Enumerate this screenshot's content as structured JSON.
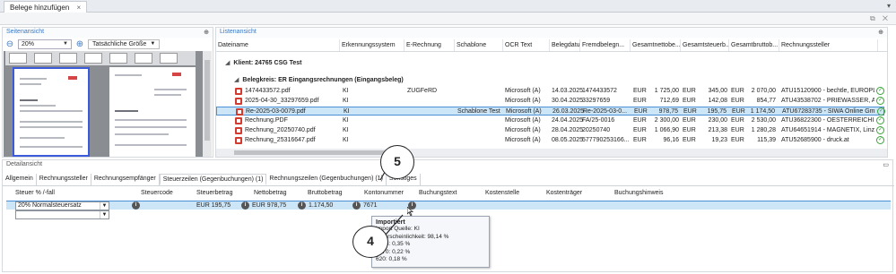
{
  "window": {
    "tab_title": "Belege hinzufügen",
    "tab_close": "×",
    "right_caret": "▾",
    "sub_icons": "⧉ ✕"
  },
  "left_panel": {
    "title": "Seitenansicht",
    "pin": "⊕",
    "zoom_value": "20%",
    "actual_size_label": "Tatsächliche Größe"
  },
  "list_panel": {
    "title": "Listenansicht",
    "pin": "⊕",
    "columns": [
      "Dateiname",
      "Erkennungssystem",
      "E-Rechnung",
      "Schablone",
      "OCR Text",
      "Belegdatu...",
      "Fremdbelegn...",
      "Gesamtnettobe...",
      "Gesamtsteuerb...",
      "Gesamtbruttob...",
      "Rechnungssteller"
    ],
    "group1": "Klient: 24765 CSG Test",
    "group2": "Belegkreis: ER Eingangsrechnungen (Eingangsbeleg)",
    "rows": [
      {
        "file": "1474433572.pdf",
        "sys": "KI",
        "erech": "ZUGFeRD",
        "schab": "",
        "ocr": "Microsoft (A)",
        "date": "14.03.2025",
        "fremd": "1474433572",
        "cur1": "EUR",
        "net": "1 725,00",
        "cur2": "EUR",
        "tax": "345,00",
        "cur3": "EUR",
        "gross": "2 070,00",
        "steller": "ATU15120900 - bechtle, EUROPLAZ"
      },
      {
        "file": "2025-04-30_33297659.pdf",
        "sys": "KI",
        "erech": "",
        "schab": "",
        "ocr": "Microsoft (A)",
        "date": "30.04.2025",
        "fremd": "33297659",
        "cur1": "EUR",
        "net": "712,69",
        "cur2": "EUR",
        "tax": "142,08",
        "cur3": "EUR",
        "gross": "854,77",
        "steller": "ATU43538702 - PRIEWASSER, A-49"
      },
      {
        "file": "Re-2025-03-0079.pdf",
        "sys": "KI",
        "erech": "",
        "schab": "Schablone Test",
        "ocr": "Microsoft (A)",
        "date": "26.03.2025",
        "fremd": "Re-2025-03-0...",
        "cur1": "EUR",
        "net": "978,75",
        "cur2": "EUR",
        "tax": "195,75",
        "cur3": "EUR",
        "gross": "1 174,50",
        "steller": "ATU67283735 - SIWA Online GmbH"
      },
      {
        "file": "Rechnung.PDF",
        "sys": "KI",
        "erech": "",
        "schab": "",
        "ocr": "Microsoft (A)",
        "date": "24.04.2025",
        "fremd": "FA/25-0016",
        "cur1": "EUR",
        "net": "2 300,00",
        "cur2": "EUR",
        "tax": "230,00",
        "cur3": "EUR",
        "gross": "2 530,00",
        "steller": "ATU36822300 - OESTERREICHISCH"
      },
      {
        "file": "Rechnung_20250740.pdf",
        "sys": "KI",
        "erech": "",
        "schab": "",
        "ocr": "Microsoft (A)",
        "date": "28.04.2025",
        "fremd": "20250740",
        "cur1": "EUR",
        "net": "1 066,90",
        "cur2": "EUR",
        "tax": "213,38",
        "cur3": "EUR",
        "gross": "1 280,28",
        "steller": "ATU64651914 - MAGNETIX, Linzer"
      },
      {
        "file": "Rechnung_25316647.pdf",
        "sys": "KI",
        "erech": "",
        "schab": "",
        "ocr": "Microsoft (A)",
        "date": "08.05.2025",
        "fremd": "577790253166...",
        "cur1": "EUR",
        "net": "96,16",
        "cur2": "EUR",
        "tax": "19,23",
        "cur3": "EUR",
        "gross": "115,39",
        "steller": "ATU52685900 - druck.at"
      }
    ]
  },
  "detail": {
    "title": "Detailansicht",
    "max_icon": "▭",
    "tabs": [
      "Allgemein",
      "Rechnungssteller",
      "Rechnungsempfänger",
      "Steuerzeilen (Gegenbuchungen) (1)",
      "Rechnungszeilen (Gegenbuchungen) (1)",
      "Sonstiges"
    ],
    "headers": [
      "Steuer % /-fall",
      "Steuercode",
      "Steuerbetrag",
      "Nettobetrag",
      "Bruttobetrag",
      "Kontonummer",
      "Buchungstext",
      "Kostenstelle",
      "Kostenträger",
      "Buchungshinweis"
    ],
    "row": {
      "tax_case": "20% Normalsteuersatz",
      "tax_amount": "EUR 195,75",
      "net_amount": "EUR 978,75",
      "gross_amount": "1.174,50",
      "account": "7671"
    }
  },
  "tooltip": {
    "title": "Importiert",
    "lines": [
      "Import Quelle: KI",
      "Wahrscheinlichkeit: 98,14 %",
      "7273: 0,35 %",
      "7270: 0,22 %",
      "620: 0,18 %"
    ]
  },
  "callouts": {
    "a": "5",
    "b": "4"
  }
}
